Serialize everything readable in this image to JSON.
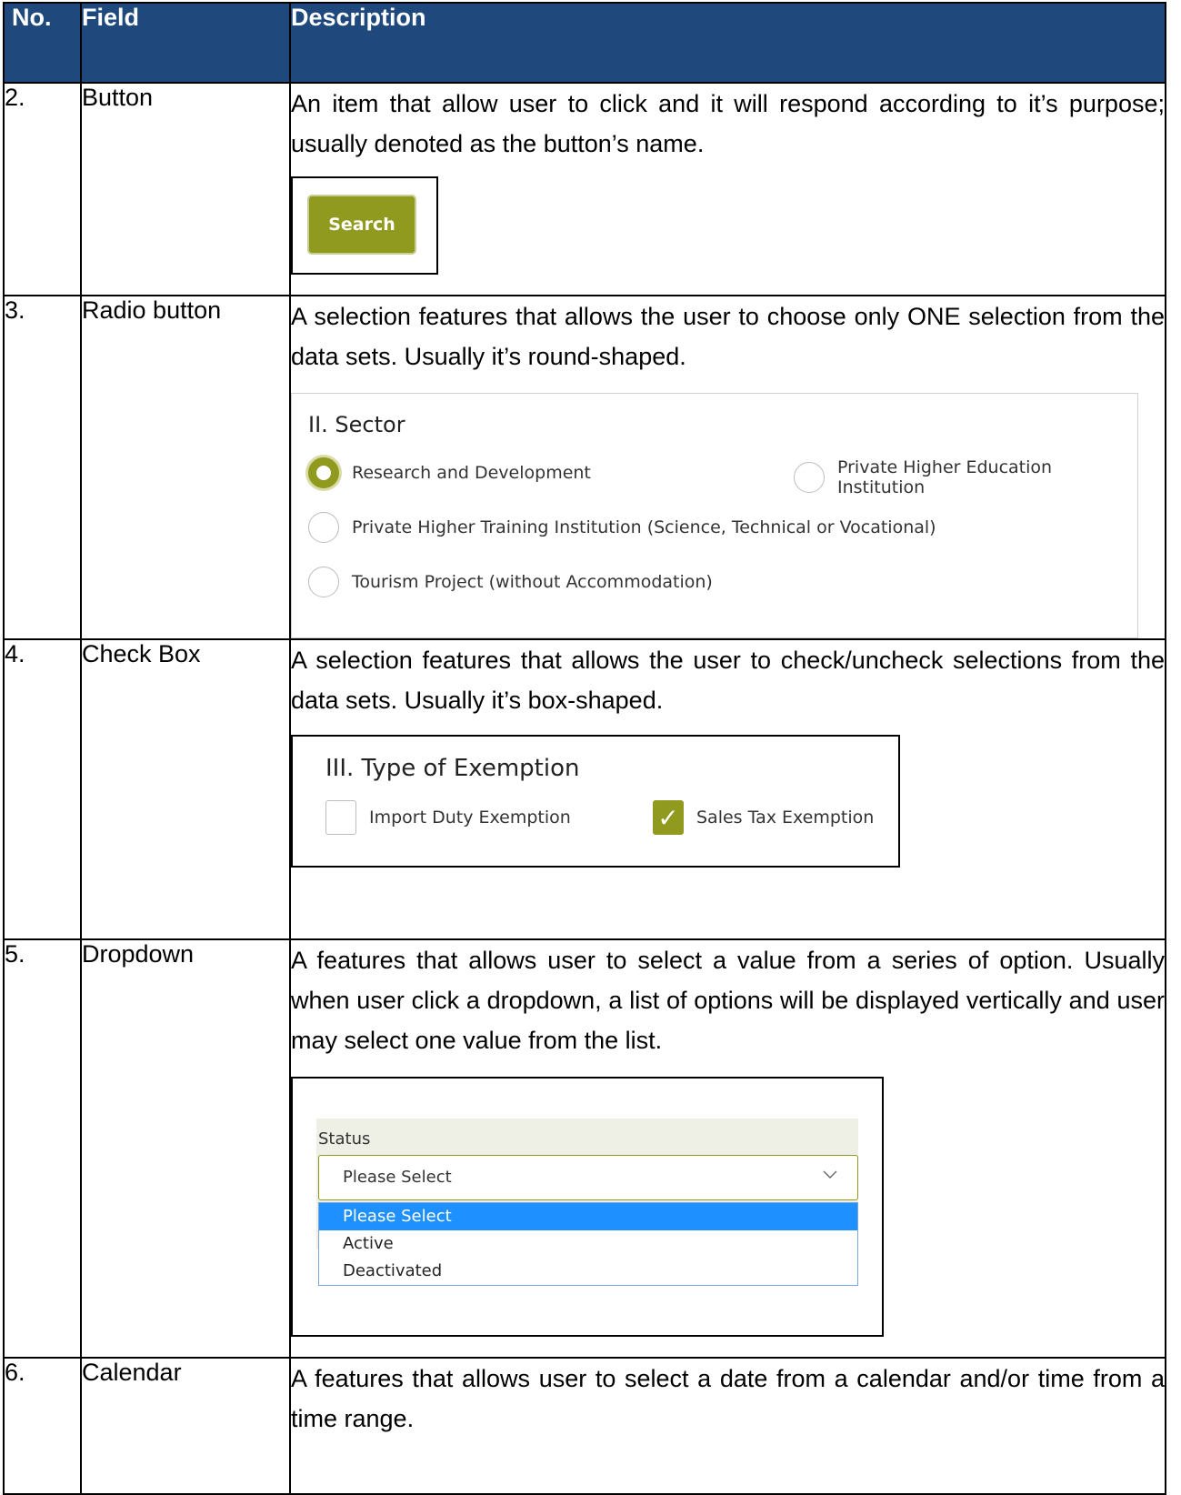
{
  "table": {
    "headers": {
      "no": "No.",
      "field": "Field",
      "description": "Description"
    },
    "rows": [
      {
        "no": "2.",
        "field": "Button",
        "description": "An item that allow user to click and it will respond according to it’s purpose; usually denoted as the button’s name."
      },
      {
        "no": "3.",
        "field": "Radio button",
        "description": "A selection features that allows the user to choose only ONE selection from the data sets. Usually it’s round-shaped."
      },
      {
        "no": "4.",
        "field": "Check Box",
        "description": "A selection features that allows the user to check/uncheck selections from the data sets. Usually it’s box-shaped."
      },
      {
        "no": "5.",
        "field": "Dropdown",
        "description": "A features that allows user to select a value from a series of option. Usually when user click a dropdown, a list of options will be displayed vertically and user may select one value from the list."
      },
      {
        "no": "6.",
        "field": "Calendar",
        "description": "A features that allows user to select a date from a calendar and/or time from a time range."
      }
    ]
  },
  "examples": {
    "button": {
      "label": "Search",
      "color": "#8f9a1e"
    },
    "radio": {
      "title": "II. Sector",
      "options": [
        {
          "label": "Research and Development",
          "selected": true
        },
        {
          "label": "Private Higher Education Institution",
          "selected": false
        },
        {
          "label": "Private Higher Training Institution (Science, Technical or Vocational)",
          "selected": false
        },
        {
          "label": "Tourism Project (without Accommodation)",
          "selected": false
        }
      ]
    },
    "checkbox": {
      "title": "III. Type of Exemption",
      "options": [
        {
          "label": "Import Duty Exemption",
          "checked": false
        },
        {
          "label": "Sales Tax Exemption",
          "checked": true
        }
      ]
    },
    "dropdown": {
      "label": "Status",
      "value": "Please Select",
      "options": [
        "Please Select",
        "Active",
        "Deactivated"
      ],
      "icon": "chevron-down-icon"
    }
  },
  "colors": {
    "header_bg": "#1f497d",
    "accent": "#8f9a1e",
    "highlight": "#1e90ff"
  }
}
